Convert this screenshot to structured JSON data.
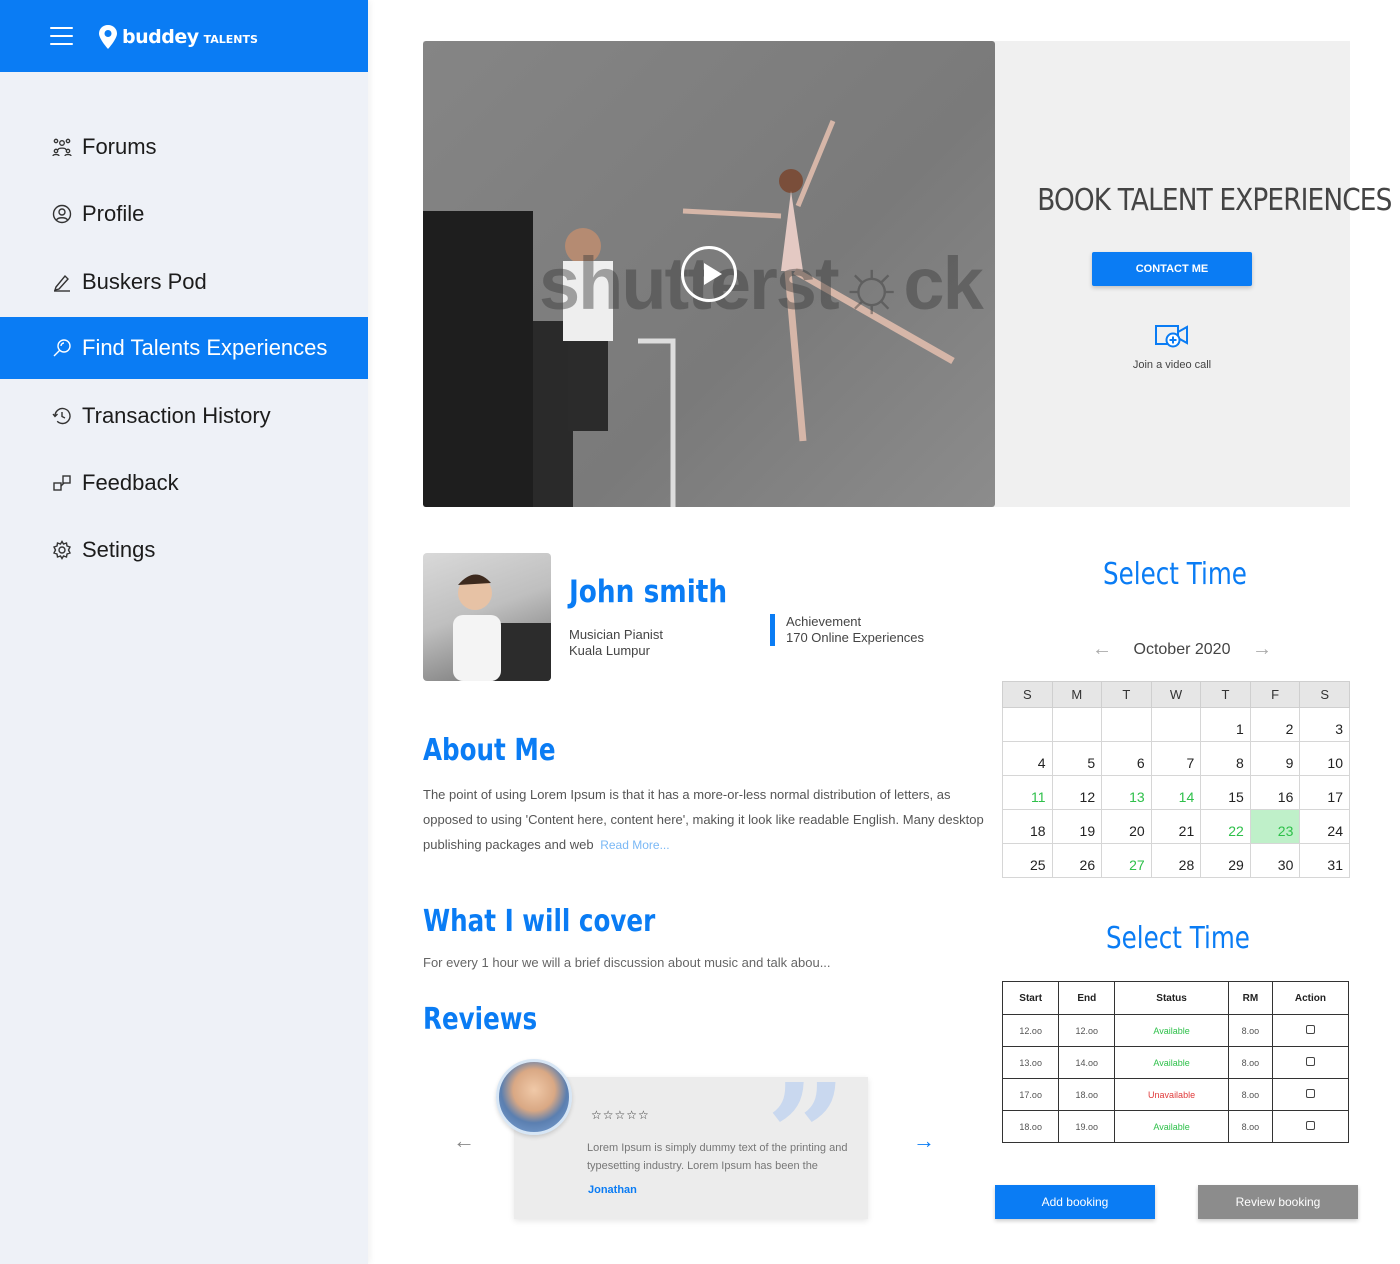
{
  "brand": {
    "name": "buddey",
    "sub": "TALENTS"
  },
  "sidebar": {
    "items": [
      {
        "label": "Forums",
        "icon": "forums-icon"
      },
      {
        "label": "Profile",
        "icon": "profile-icon"
      },
      {
        "label": "Buskers Pod",
        "icon": "pen-icon"
      },
      {
        "label": "Find Talents Experiences",
        "icon": "search-icon",
        "active": true
      },
      {
        "label": "Transaction History",
        "icon": "history-icon"
      },
      {
        "label": "Feedback",
        "icon": "feedback-icon"
      },
      {
        "label": "Setings",
        "icon": "gear-icon"
      }
    ]
  },
  "hero": {
    "watermark": "shutterst☼ck",
    "title": "BOOK TALENT EXPERIENCES",
    "contact_label": "CONTACT ME",
    "video_call_label": "Join a video call"
  },
  "profile": {
    "name": "John smith",
    "role": "Musician Pianist",
    "location": "Kuala Lumpur",
    "achievement_label": "Achievement",
    "achievement_value": "170 Online Experiences"
  },
  "about": {
    "title": "About Me",
    "text": "The point of using Lorem Ipsum is that it has a more-or-less normal distribution of letters, as opposed to using 'Content here, content here', making it look like readable English. Many desktop publishing packages and web",
    "read_more": "Read More..."
  },
  "cover": {
    "title": "What I will cover",
    "text": "For every 1 hour we will a brief discussion about music and talk abou..."
  },
  "reviews": {
    "title": "Reviews",
    "stars": "☆☆☆☆☆",
    "rating": 5,
    "text": "Lorem Ipsum is simply dummy text of the printing and typesetting industry. Lorem Ipsum has been the",
    "author": "Jonathan"
  },
  "calendar": {
    "title": "Select Time",
    "month": "October 2020",
    "weekdays": [
      "S",
      "M",
      "T",
      "W",
      "T",
      "F",
      "S"
    ],
    "weeks": [
      [
        "",
        "",
        "",
        "",
        "1",
        "2",
        "3"
      ],
      [
        "4",
        "5",
        "6",
        "7",
        "8",
        "9",
        "10"
      ],
      [
        "11",
        "12",
        "13",
        "14",
        "15",
        "16",
        "17"
      ],
      [
        "18",
        "19",
        "20",
        "21",
        "22",
        "23",
        "24"
      ],
      [
        "25",
        "26",
        "27",
        "28",
        "29",
        "30",
        "31"
      ]
    ],
    "available_days": [
      "11",
      "13",
      "14",
      "22",
      "23",
      "27"
    ],
    "selected_day": "23",
    "accent_green": "#2ec04a"
  },
  "slots": {
    "title": "Select Time",
    "headers": [
      "Start",
      "End",
      "Status",
      "RM",
      "Action"
    ],
    "rows": [
      {
        "start": "12.oo",
        "end": "12.oo",
        "status": "Available",
        "rm": "8.oo"
      },
      {
        "start": "13.oo",
        "end": "14.oo",
        "status": "Available",
        "rm": "8.oo"
      },
      {
        "start": "17.oo",
        "end": "18.oo",
        "status": "Unavailable",
        "rm": "8.oo"
      },
      {
        "start": "18.oo",
        "end": "19.oo",
        "status": "Available",
        "rm": "8.oo"
      }
    ]
  },
  "actions": {
    "add_booking": "Add booking",
    "review_booking": "Review  booking"
  },
  "colors": {
    "accent": "#0a7cf4",
    "sidebar_bg": "#eef1f7"
  }
}
